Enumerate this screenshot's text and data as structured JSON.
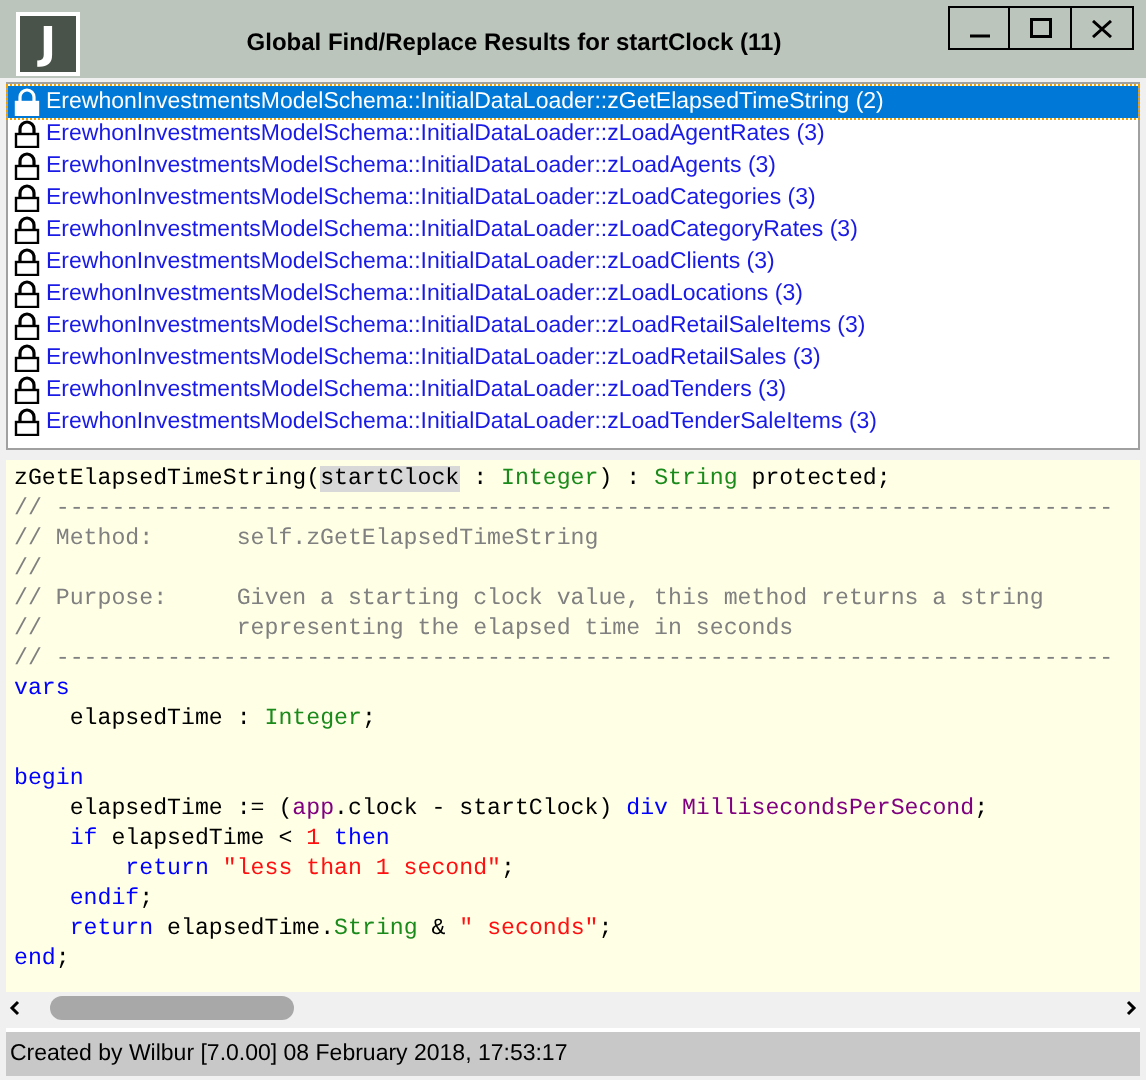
{
  "window": {
    "logo": "J",
    "title": "Global Find/Replace Results for startClock (11)",
    "controls": [
      {
        "kind": "minimize"
      },
      {
        "kind": "maximize"
      },
      {
        "kind": "close"
      }
    ]
  },
  "results": [
    {
      "text": "ErewhonInvestmentsModelSchema::InitialDataLoader::zGetElapsedTimeString (2)",
      "selected": true
    },
    {
      "text": "ErewhonInvestmentsModelSchema::InitialDataLoader::zLoadAgentRates (3)",
      "selected": false
    },
    {
      "text": "ErewhonInvestmentsModelSchema::InitialDataLoader::zLoadAgents (3)",
      "selected": false
    },
    {
      "text": "ErewhonInvestmentsModelSchema::InitialDataLoader::zLoadCategories (3)",
      "selected": false
    },
    {
      "text": "ErewhonInvestmentsModelSchema::InitialDataLoader::zLoadCategoryRates (3)",
      "selected": false
    },
    {
      "text": "ErewhonInvestmentsModelSchema::InitialDataLoader::zLoadClients (3)",
      "selected": false
    },
    {
      "text": "ErewhonInvestmentsModelSchema::InitialDataLoader::zLoadLocations (3)",
      "selected": false
    },
    {
      "text": "ErewhonInvestmentsModelSchema::InitialDataLoader::zLoadRetailSaleItems (3)",
      "selected": false
    },
    {
      "text": "ErewhonInvestmentsModelSchema::InitialDataLoader::zLoadRetailSales (3)",
      "selected": false
    },
    {
      "text": "ErewhonInvestmentsModelSchema::InitialDataLoader::zLoadTenders (3)",
      "selected": false
    },
    {
      "text": "ErewhonInvestmentsModelSchema::InitialDataLoader::zLoadTenderSaleItems (3)",
      "selected": false
    }
  ],
  "code": [
    {
      "kind": "code",
      "tokens": [
        {
          "text": "zGetElapsedTimeString(",
          "kind": "plain"
        },
        {
          "text": "startClock",
          "kind": "match"
        },
        {
          "text": " : ",
          "kind": "plain"
        },
        {
          "text": "Integer",
          "kind": "type"
        },
        {
          "text": ") : ",
          "kind": "plain"
        },
        {
          "text": "String",
          "kind": "type"
        },
        {
          "text": " protected;",
          "kind": "plain"
        }
      ]
    },
    {
      "kind": "code",
      "tokens": [
        {
          "text": "// ----------------------------------------------------------------------------",
          "kind": "comment"
        }
      ]
    },
    {
      "kind": "code",
      "tokens": [
        {
          "text": "// Method:      self.zGetElapsedTimeString",
          "kind": "comment"
        }
      ]
    },
    {
      "kind": "code",
      "tokens": [
        {
          "text": "//",
          "kind": "comment"
        }
      ]
    },
    {
      "kind": "code",
      "tokens": [
        {
          "text": "// Purpose:     Given a starting clock value, this method returns a string",
          "kind": "comment"
        }
      ]
    },
    {
      "kind": "code",
      "tokens": [
        {
          "text": "//              representing the elapsed time in seconds",
          "kind": "comment"
        }
      ]
    },
    {
      "kind": "code",
      "tokens": [
        {
          "text": "// ----------------------------------------------------------------------------",
          "kind": "comment"
        }
      ]
    },
    {
      "kind": "code",
      "tokens": [
        {
          "text": "vars",
          "kind": "keyword"
        }
      ]
    },
    {
      "kind": "code",
      "tokens": [
        {
          "text": "    elapsedTime : ",
          "kind": "plain"
        },
        {
          "text": "Integer",
          "kind": "type"
        },
        {
          "text": ";",
          "kind": "plain"
        }
      ]
    },
    {
      "kind": "blank"
    },
    {
      "kind": "code",
      "tokens": [
        {
          "text": "begin",
          "kind": "keyword"
        }
      ]
    },
    {
      "kind": "code",
      "tokens": [
        {
          "text": "    elapsedTime := (",
          "kind": "plain"
        },
        {
          "text": "app",
          "kind": "constant"
        },
        {
          "text": ".clock - startClock) ",
          "kind": "plain"
        },
        {
          "text": "div",
          "kind": "keyword"
        },
        {
          "text": " MillisecondsPerSecond",
          "kind": "constant"
        },
        {
          "text": ";",
          "kind": "plain"
        }
      ]
    },
    {
      "kind": "code",
      "tokens": [
        {
          "text": "    if",
          "kind": "keyword"
        },
        {
          "text": " elapsedTime < ",
          "kind": "plain"
        },
        {
          "text": "1",
          "kind": "literal"
        },
        {
          "text": " then",
          "kind": "keyword"
        }
      ]
    },
    {
      "kind": "code",
      "tokens": [
        {
          "text": "        return",
          "kind": "keyword"
        },
        {
          "text": " \"less than 1 second\"",
          "kind": "literal"
        },
        {
          "text": ";",
          "kind": "plain"
        }
      ]
    },
    {
      "kind": "code",
      "tokens": [
        {
          "text": "    endif",
          "kind": "keyword"
        },
        {
          "text": ";",
          "kind": "plain"
        }
      ]
    },
    {
      "kind": "code",
      "tokens": [
        {
          "text": "    return",
          "kind": "keyword"
        },
        {
          "text": " elapsedTime.",
          "kind": "plain"
        },
        {
          "text": "String",
          "kind": "type"
        },
        {
          "text": " & ",
          "kind": "plain"
        },
        {
          "text": "\" seconds\"",
          "kind": "literal"
        },
        {
          "text": ";",
          "kind": "plain"
        }
      ]
    },
    {
      "kind": "code",
      "tokens": [
        {
          "text": "end",
          "kind": "keyword"
        },
        {
          "text": ";",
          "kind": "plain"
        }
      ]
    }
  ],
  "status_bar": "Created by Wilbur [7.0.00] 08 February 2018, 17:53:17"
}
